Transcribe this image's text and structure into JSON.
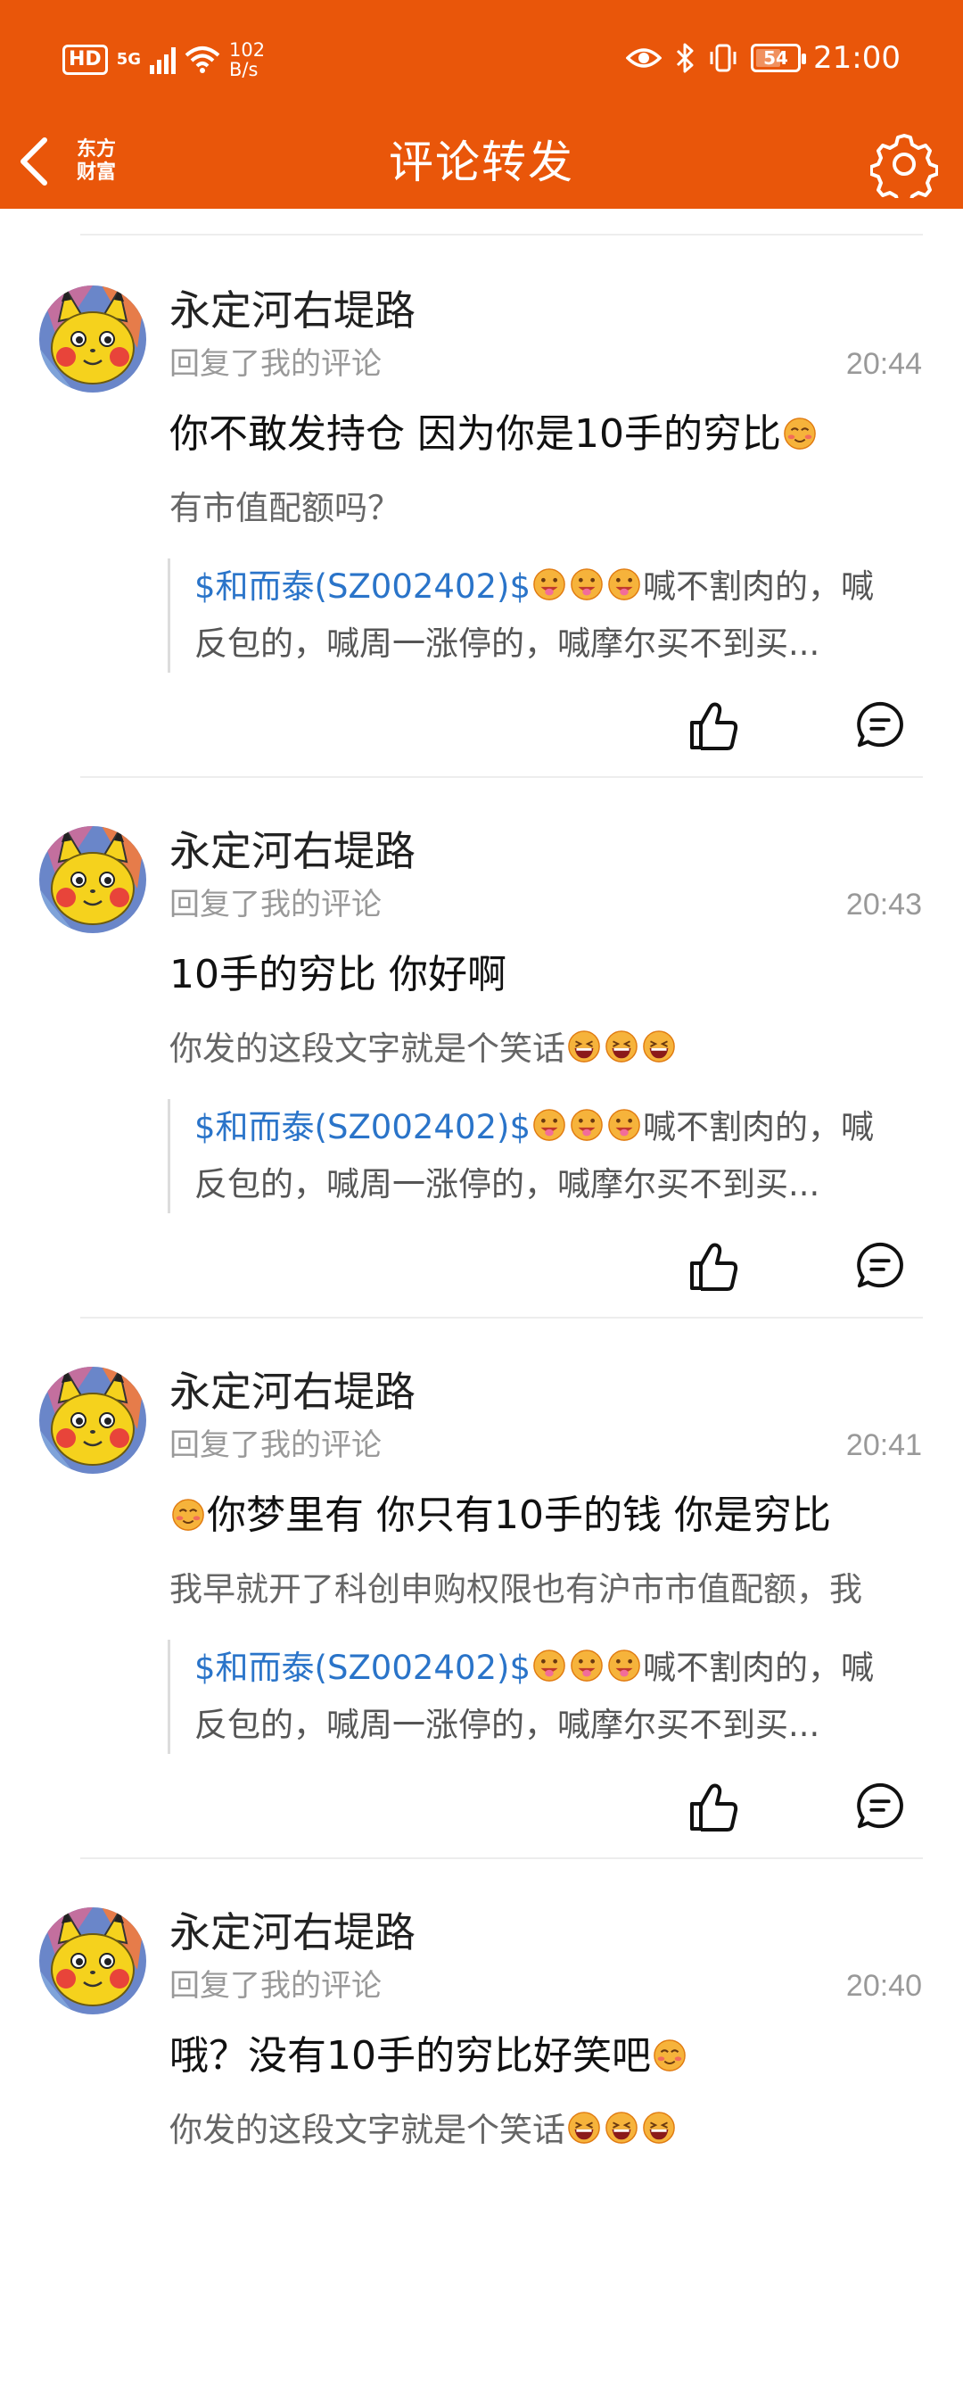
{
  "status_bar": {
    "hd": "HD",
    "network": "5G",
    "speed_value": "102",
    "speed_unit": "B/s",
    "battery": "54",
    "time": "21:00"
  },
  "nav": {
    "logo_line1": "东方",
    "logo_line2": "财富",
    "title": "评论转发",
    "back_icon": "chevron-left-icon",
    "settings_icon": "gear-icon"
  },
  "colors": {
    "brand": "#e9560a",
    "link": "#2a74c9",
    "muted": "#999999"
  },
  "items": [
    {
      "name": "永定河右堤路",
      "sub": "回复了我的评论",
      "time": "20:44",
      "reply_prefix": "",
      "reply": "你不敢发持仓 因为你是10手的穷比",
      "quote": "有市值配额吗？",
      "stock": "$和而泰(SZ002402)$",
      "orig_line1": "喊不割肉的，喊",
      "orig_line2": "反包的，喊周一涨停的，喊摩尔买不到买..."
    },
    {
      "name": "永定河右堤路",
      "sub": "回复了我的评论",
      "time": "20:43",
      "reply_prefix": "",
      "reply": "10手的穷比 你好啊",
      "quote": "你发的这段文字就是个笑话",
      "stock": "$和而泰(SZ002402)$",
      "orig_line1": "喊不割肉的，喊",
      "orig_line2": "反包的，喊周一涨停的，喊摩尔买不到买..."
    },
    {
      "name": "永定河右堤路",
      "sub": "回复了我的评论",
      "time": "20:41",
      "reply_prefix": "",
      "reply": "你梦里有 你只有10手的钱 你是穷比",
      "quote": "我早就开了科创申购权限也有沪市市值配额，我",
      "stock": "$和而泰(SZ002402)$",
      "orig_line1": "喊不割肉的，喊",
      "orig_line2": "反包的，喊周一涨停的，喊摩尔买不到买..."
    },
    {
      "name": "永定河右堤路",
      "sub": "回复了我的评论",
      "time": "20:40",
      "reply_prefix": "",
      "reply": "哦？没有10手的穷比好笑吧",
      "quote": "你发的这段文字就是个笑话",
      "stock": "",
      "orig_line1": "",
      "orig_line2": ""
    }
  ]
}
